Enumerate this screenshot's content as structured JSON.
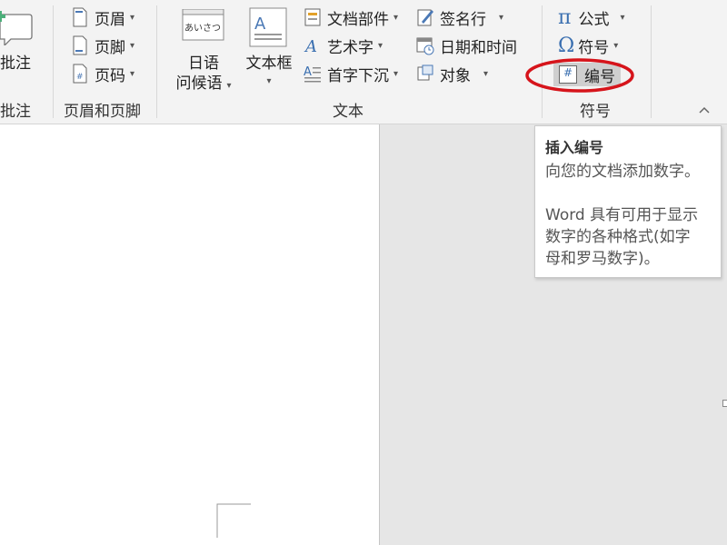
{
  "comment": {
    "label": "批注",
    "group": "批注"
  },
  "header_footer": {
    "items": [
      {
        "label": "页眉"
      },
      {
        "label": "页脚"
      },
      {
        "label": "页码"
      }
    ],
    "group": "页眉和页脚"
  },
  "text_group": {
    "japanese": {
      "icon_text": "あいさつ",
      "line1": "日语",
      "line2": "问候语"
    },
    "textbox": {
      "label": "文本框"
    },
    "parts": [
      {
        "label": "文档部件"
      },
      {
        "label": "艺术字"
      },
      {
        "label": "首字下沉"
      }
    ],
    "right": [
      {
        "label": "签名行"
      },
      {
        "label": "日期和时间"
      },
      {
        "label": "对象"
      }
    ],
    "group": "文本"
  },
  "symbols": {
    "equation": {
      "glyph": "π",
      "label": "公式"
    },
    "symbol": {
      "glyph": "Ω",
      "label": "符号"
    },
    "number": {
      "glyph": "#",
      "label": "编号"
    },
    "group": "符号",
    "highlight_color": "#d6141b"
  },
  "tooltip": {
    "title": "插入编号",
    "line1": "向您的文档添加数字。",
    "para2_line1": "Word 具有可用于显示",
    "para2_line2": "数字的各种格式(如字",
    "para2_line3": "母和罗马数字)。"
  },
  "collapse_glyph": "^",
  "dropdown_glyph": "▾"
}
